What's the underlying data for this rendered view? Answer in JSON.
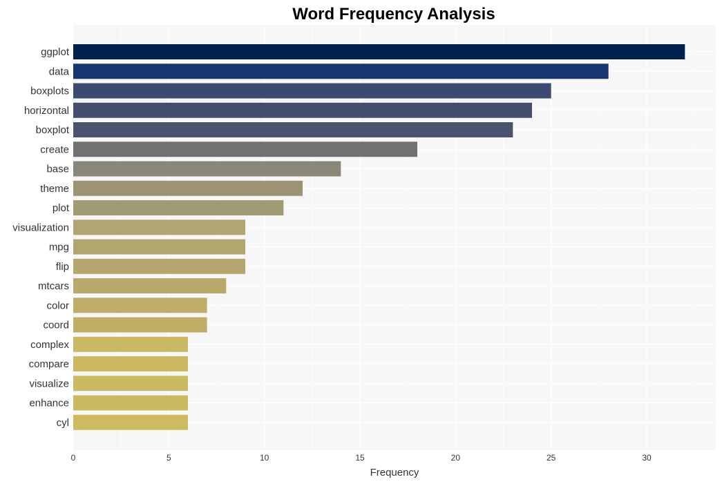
{
  "chart_data": {
    "type": "bar",
    "orientation": "horizontal",
    "title": "Word Frequency Analysis",
    "xlabel": "Frequency",
    "ylabel": "",
    "xlim": [
      0,
      33.6
    ],
    "xticks": [
      0,
      5,
      10,
      15,
      20,
      25,
      30
    ],
    "grid": true,
    "categories": [
      "ggplot",
      "data",
      "boxplots",
      "horizontal",
      "boxplot",
      "create",
      "base",
      "theme",
      "plot",
      "visualization",
      "mpg",
      "flip",
      "mtcars",
      "color",
      "coord",
      "complex",
      "compare",
      "visualize",
      "enhance",
      "cyl"
    ],
    "values": [
      32,
      28,
      25,
      24,
      23,
      18,
      14,
      12,
      11,
      9,
      9,
      9,
      8,
      7,
      7,
      6,
      6,
      6,
      6,
      6
    ],
    "colors": [
      "#00204d",
      "#183670",
      "#3a4a72",
      "#434e6c",
      "#495370",
      "#707173",
      "#898778",
      "#9a9374",
      "#a19b74",
      "#b1a571",
      "#b2a56f",
      "#b4a66f",
      "#b9aa6c",
      "#c0ad67",
      "#c1ae66",
      "#c9b862",
      "#cab862",
      "#cbb962",
      "#cbba62",
      "#cdba61"
    ],
    "background": "#f7f7f7",
    "gridColor": "#ffffff"
  }
}
